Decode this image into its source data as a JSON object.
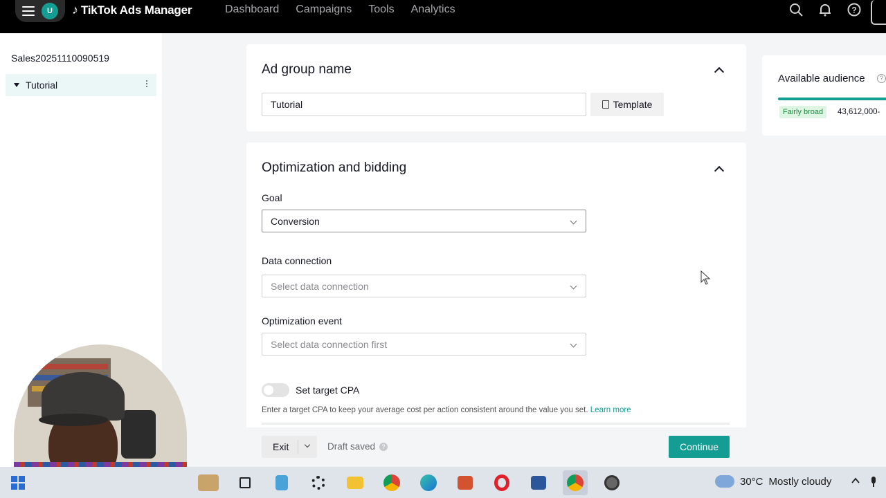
{
  "topbar": {
    "user_initial": "U",
    "brand": "TikTok Ads Manager",
    "nav": [
      "Dashboard",
      "Campaigns",
      "Tools",
      "Analytics"
    ]
  },
  "sidebar": {
    "campaign_name": "Sales20251110090519",
    "items": [
      {
        "label": "Tutorial"
      }
    ]
  },
  "ad_group": {
    "section_title": "Ad group name",
    "name_value": "Tutorial",
    "template_label": "Template"
  },
  "optimization": {
    "section_title": "Optimization and bidding",
    "goal_label": "Goal",
    "goal_value": "Conversion",
    "data_connection_label": "Data connection",
    "data_connection_placeholder": "Select data connection",
    "optimization_event_label": "Optimization event",
    "optimization_event_placeholder": "Select data connection first",
    "target_cpa_label": "Set target CPA",
    "target_cpa_enabled": false,
    "hint_text": "Enter a target CPA to keep your average cost per action consistent around the value you set.",
    "learn_more": "Learn more"
  },
  "audience": {
    "title": "Available audience",
    "badge": "Fairly broad",
    "count": "43,612,000-"
  },
  "footer": {
    "exit_label": "Exit",
    "draft_status": "Draft saved",
    "continue_label": "Continue"
  },
  "taskbar": {
    "temperature": "30°C",
    "weather": "Mostly cloudy"
  },
  "colors": {
    "accent": "#149d93",
    "topbar_bg": "#000000",
    "badge_bg": "#dff5e3",
    "badge_text": "#1b8a3d"
  }
}
